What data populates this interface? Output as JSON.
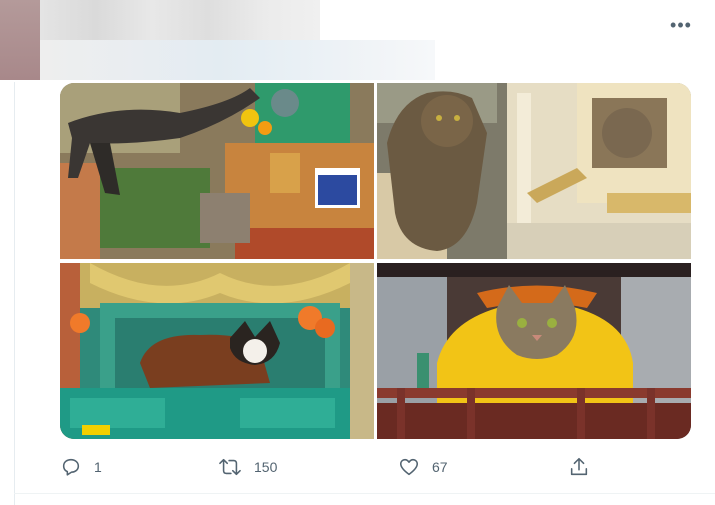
{
  "tweet": {
    "menu": {
      "icon": "more-horizontal-icon",
      "label": "•••"
    },
    "media": [
      {
        "description_icon": "photo-cat-leaping-shrine"
      },
      {
        "description_icon": "photo-cat-spirit-house"
      },
      {
        "description_icon": "photo-cat-teal-shrine"
      },
      {
        "description_icon": "photo-cat-yellow-cloth"
      }
    ],
    "actions": {
      "reply": {
        "icon": "reply-icon",
        "count": "1"
      },
      "retweet": {
        "icon": "retweet-icon",
        "count": "150"
      },
      "like": {
        "icon": "heart-icon",
        "count": "67"
      },
      "share": {
        "icon": "share-icon",
        "count": ""
      }
    }
  },
  "colors": {
    "icon_gray": "#536471",
    "divider": "#eff3f4"
  }
}
